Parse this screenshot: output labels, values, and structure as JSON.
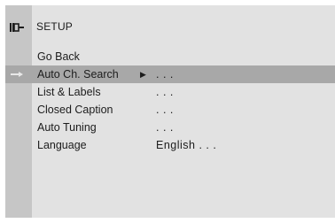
{
  "header": {
    "icon": "setup-plug-icon",
    "title": "SETUP"
  },
  "menu": {
    "items": [
      {
        "label": "Go Back",
        "arrow": "",
        "value": ""
      },
      {
        "label": "Auto Ch. Search",
        "arrow": "▶",
        "value": ". . ."
      },
      {
        "label": "List & Labels",
        "arrow": "",
        "value": ". . ."
      },
      {
        "label": "Closed Caption",
        "arrow": "",
        "value": ". . ."
      },
      {
        "label": "Auto Tuning",
        "arrow": "",
        "value": ". . ."
      },
      {
        "label": "Language",
        "arrow": "",
        "value": "English . . ."
      }
    ],
    "selected_index": 1,
    "pointer_icon": "selection-pointer-icon"
  },
  "colors": {
    "panel": "#e2e2e2",
    "gutter": "#c6c6c6",
    "highlight": "#a8a8a8",
    "text": "#1c1c1c"
  }
}
